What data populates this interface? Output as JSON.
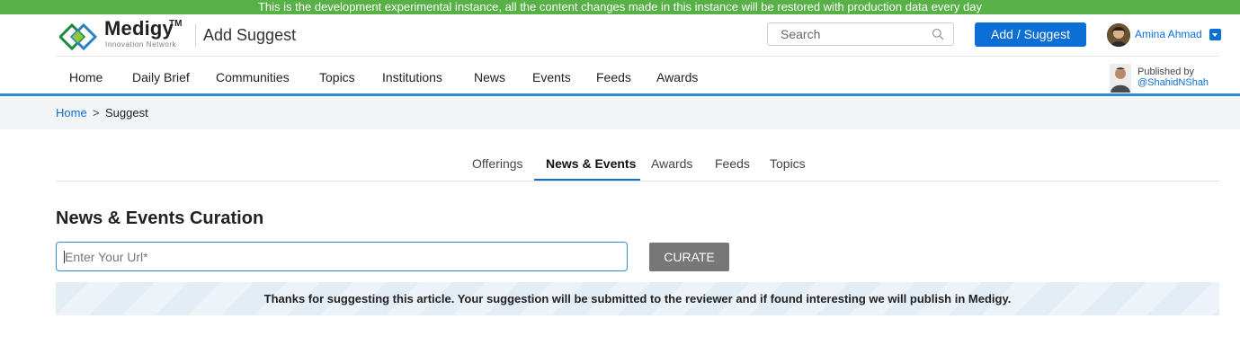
{
  "banner": {
    "text": "This is the development experimental instance, all the content changes made in this instance will be restored with production data every day",
    "color": "#58b146"
  },
  "header": {
    "logo_word": "Medigy",
    "logo_tm": "TM",
    "logo_sub": "Innovation Network",
    "page_heading": "Add Suggest",
    "search_placeholder": "Search",
    "search_icon": "search-icon",
    "add_button": "Add / Suggest",
    "user_name": "Amina Ahmad",
    "accent_color": "#0b6fd6"
  },
  "nav": {
    "items": [
      "Home",
      "Daily Brief",
      "Communities",
      "Topics",
      "Institutions",
      "News",
      "Events",
      "Feeds",
      "Awards"
    ],
    "published_by": "Published by",
    "publisher_handle": "@ShahidNShah"
  },
  "breadcrumb": {
    "home": "Home",
    "separator": ">",
    "current": "Suggest"
  },
  "tabs": {
    "items": [
      "Offerings",
      "News & Events",
      "Awards",
      "Feeds",
      "Topics"
    ],
    "active": "News & Events"
  },
  "curation": {
    "title": "News & Events Curation",
    "url_placeholder": "Enter Your Url*",
    "curate_button": "CURATE",
    "notice": "Thanks for suggesting this article. Your suggestion will be submitted to the reviewer and if found interesting we will publish in Medigy."
  }
}
